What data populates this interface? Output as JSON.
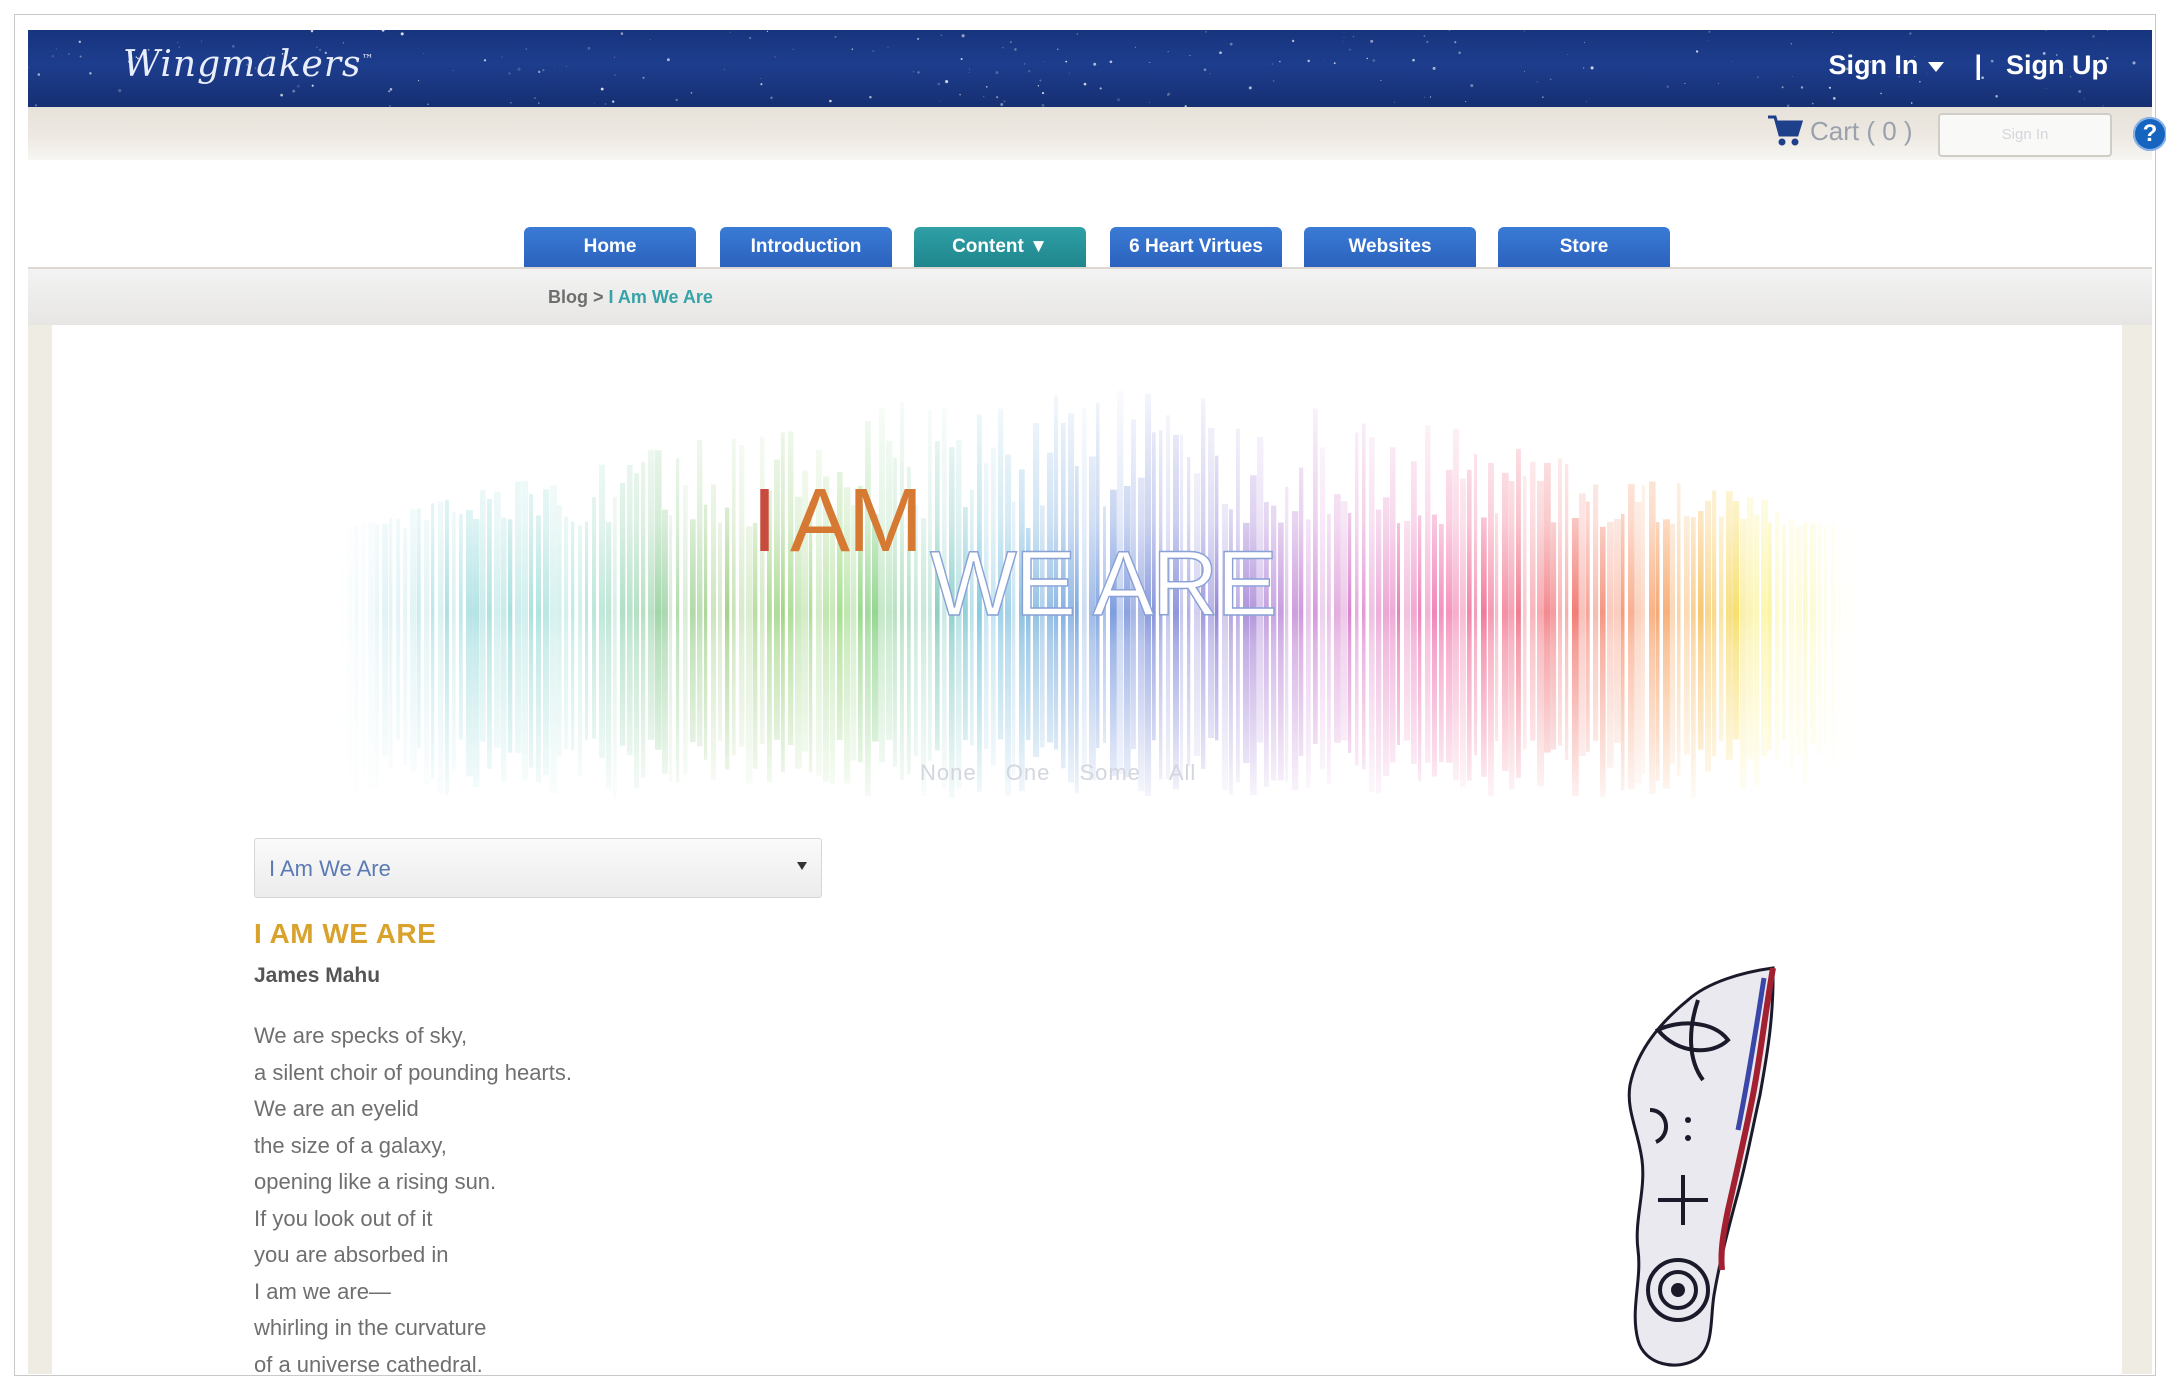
{
  "header": {
    "logo_text": "Wingmakers",
    "logo_tm": "™",
    "sign_in": "Sign In",
    "separator": "|",
    "sign_up": "Sign Up"
  },
  "subbar": {
    "cart_label": "Cart ( 0 )",
    "signin_input_placeholder": "Sign In",
    "help_label": "?"
  },
  "nav": {
    "tabs": [
      {
        "label": "Home"
      },
      {
        "label": "Introduction"
      },
      {
        "label": "Content ▼"
      },
      {
        "label": "6 Heart Virtues"
      },
      {
        "label": "Websites"
      },
      {
        "label": "Store"
      }
    ],
    "active_index": 2
  },
  "breadcrumb": {
    "parent": "Blog",
    "separator": " > ",
    "current": "I Am We Are"
  },
  "banner": {
    "title_i": "I",
    "title_am": "AM",
    "title_we_are": "WE ARE",
    "subtitle_words": [
      "None",
      "One",
      "Some",
      "All"
    ]
  },
  "post": {
    "select_value": "I Am We Are",
    "title": "I AM WE ARE",
    "author": "James Mahu",
    "poem_lines": [
      "We are specks of sky,",
      "a silent choir of pounding hearts.",
      "We are an eyelid",
      "the size of a galaxy,",
      "opening like a rising sun.",
      "If you look out of it",
      "you are absorbed in",
      "I am we are—",
      "whirling in the curvature",
      "of a universe cathedral."
    ]
  },
  "colors": {
    "header_blue": "#1d3d8d",
    "tab_blue": "#2b62be",
    "tab_active_teal": "#1f868d",
    "post_title_gold": "#d8a22c",
    "breadcrumb_current_teal": "#36a3a8"
  }
}
